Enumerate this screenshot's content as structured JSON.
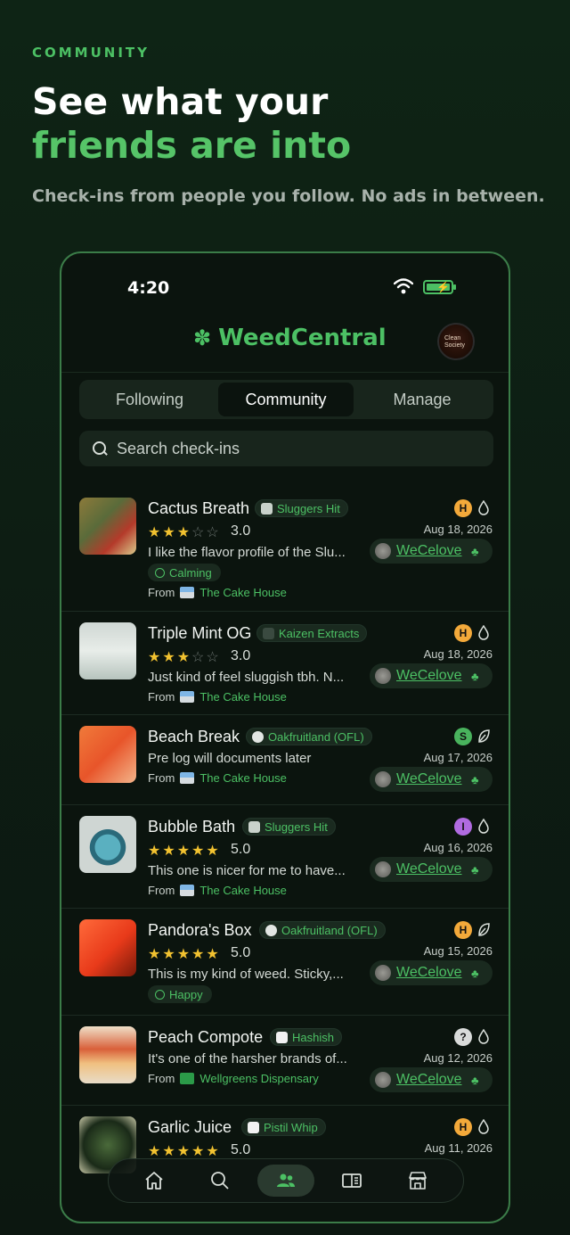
{
  "promo": {
    "eyebrow": "COMMUNITY",
    "headline_line1": "See what your",
    "headline_line2": "friends are into",
    "subtitle": "Check-ins from people you follow. No ads in between."
  },
  "status_bar": {
    "time": "4:20"
  },
  "app": {
    "name": "WeedCentral",
    "avatar_text": "Clean Society"
  },
  "tabs": [
    {
      "label": "Following",
      "active": false
    },
    {
      "label": "Community",
      "active": true
    },
    {
      "label": "Manage",
      "active": false
    }
  ],
  "search": {
    "placeholder": "Search check-ins"
  },
  "feed": [
    {
      "name": "Cactus Breath",
      "brand": "Sluggers Hit",
      "stars": "★★★☆☆",
      "rating": "3.0",
      "review": "I like the flavor profile of the Slu...",
      "tag": "Calming",
      "from_label": "From",
      "store": "The Cake House",
      "type_badge": "H",
      "date": "Aug 18, 2026",
      "user": "WeCelove"
    },
    {
      "name": "Triple Mint OG",
      "brand": "Kaizen Extracts",
      "stars": "★★★☆☆",
      "rating": "3.0",
      "review": "Just kind of feel sluggish tbh. N...",
      "from_label": "From",
      "store": "The Cake House",
      "type_badge": "H",
      "date": "Aug 18, 2026",
      "user": "WeCelove"
    },
    {
      "name": "Beach Break",
      "brand": "Oakfruitland (OFL)",
      "review": "Pre log will documents later",
      "from_label": "From",
      "store": "The Cake House",
      "type_badge": "S",
      "date": "Aug 17, 2026",
      "user": "WeCelove"
    },
    {
      "name": "Bubble Bath",
      "brand": "Sluggers Hit",
      "stars": "★★★★★",
      "rating": "5.0",
      "review": "This one is nicer for me to have...",
      "from_label": "From",
      "store": "The Cake House",
      "type_badge": "I",
      "date": "Aug 16, 2026",
      "user": "WeCelove"
    },
    {
      "name": "Pandora's Box",
      "brand": "Oakfruitland (OFL)",
      "stars": "★★★★★",
      "rating": "5.0",
      "review": "This is my kind of weed. Sticky,...",
      "tag": "Happy",
      "type_badge": "H",
      "date": "Aug 15, 2026",
      "user": "WeCelove"
    },
    {
      "name": "Peach Compote",
      "brand": "Hashish",
      "review": "It's one of the harsher brands of...",
      "from_label": "From",
      "store": "Wellgreens Dispensary",
      "type_badge": "?",
      "date": "Aug 12, 2026",
      "user": "WeCelove"
    },
    {
      "name": "Garlic Juice",
      "brand": "Pistil Whip",
      "stars": "★★★★★",
      "rating": "5.0",
      "type_badge": "H",
      "date": "Aug 11, 2026"
    }
  ],
  "bottom_nav": [
    "home-icon",
    "search-icon",
    "community-icon",
    "journal-icon",
    "store-icon"
  ],
  "colors": {
    "accent": "#4cc064",
    "background": "#0b140e",
    "star": "#f2c230"
  }
}
